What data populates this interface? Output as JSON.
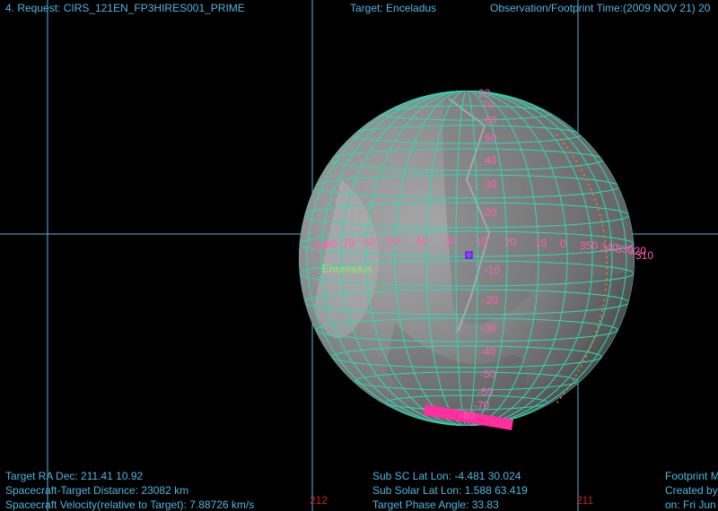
{
  "header": {
    "request": "4. Request: CIRS_121EN_FP3HIRES001_PRIME",
    "target": "Target: Enceladus",
    "time": "Observation/Footprint Time:(2009 NOV 21) 20"
  },
  "body_label": "Enceladus",
  "footer": {
    "ra_dec": "Target RA Dec: 211.41   10.92",
    "distance": "Spacecraft-Target Distance:    23082 km",
    "velocity": "Spacecraft Velocity(relative to Target): 7.88726 km/s",
    "sub_sc": "Sub SC Lat Lon:  -4.481   30.024",
    "sub_solar": "Sub Solar Lat Lon:   1.588   63.419",
    "phase": "Target Phase Angle: 33.83",
    "fp_1": "Footprint M",
    "fp_2": "Created by",
    "fp_3": "on: Fri Jun"
  },
  "sky_grid_labels": [
    "212",
    "211"
  ],
  "lat_labels": [
    "70",
    "60",
    "50",
    "40",
    "30",
    "20",
    "10",
    "0",
    "-10",
    "-20",
    "-30",
    "-40",
    "-50",
    "-60",
    "-70",
    "-80",
    "20"
  ],
  "lon_labels": [
    "90",
    "80",
    "70",
    "60",
    "50",
    "40",
    "30",
    "20",
    "10",
    "0",
    "350",
    "340",
    "330",
    "320",
    "310"
  ],
  "colors": {
    "sky_grid": "#4fb7e0",
    "planet_grid": "#2fd8b8",
    "label_pink": "#ff5fb0",
    "footprint": "#ff2fa0"
  }
}
